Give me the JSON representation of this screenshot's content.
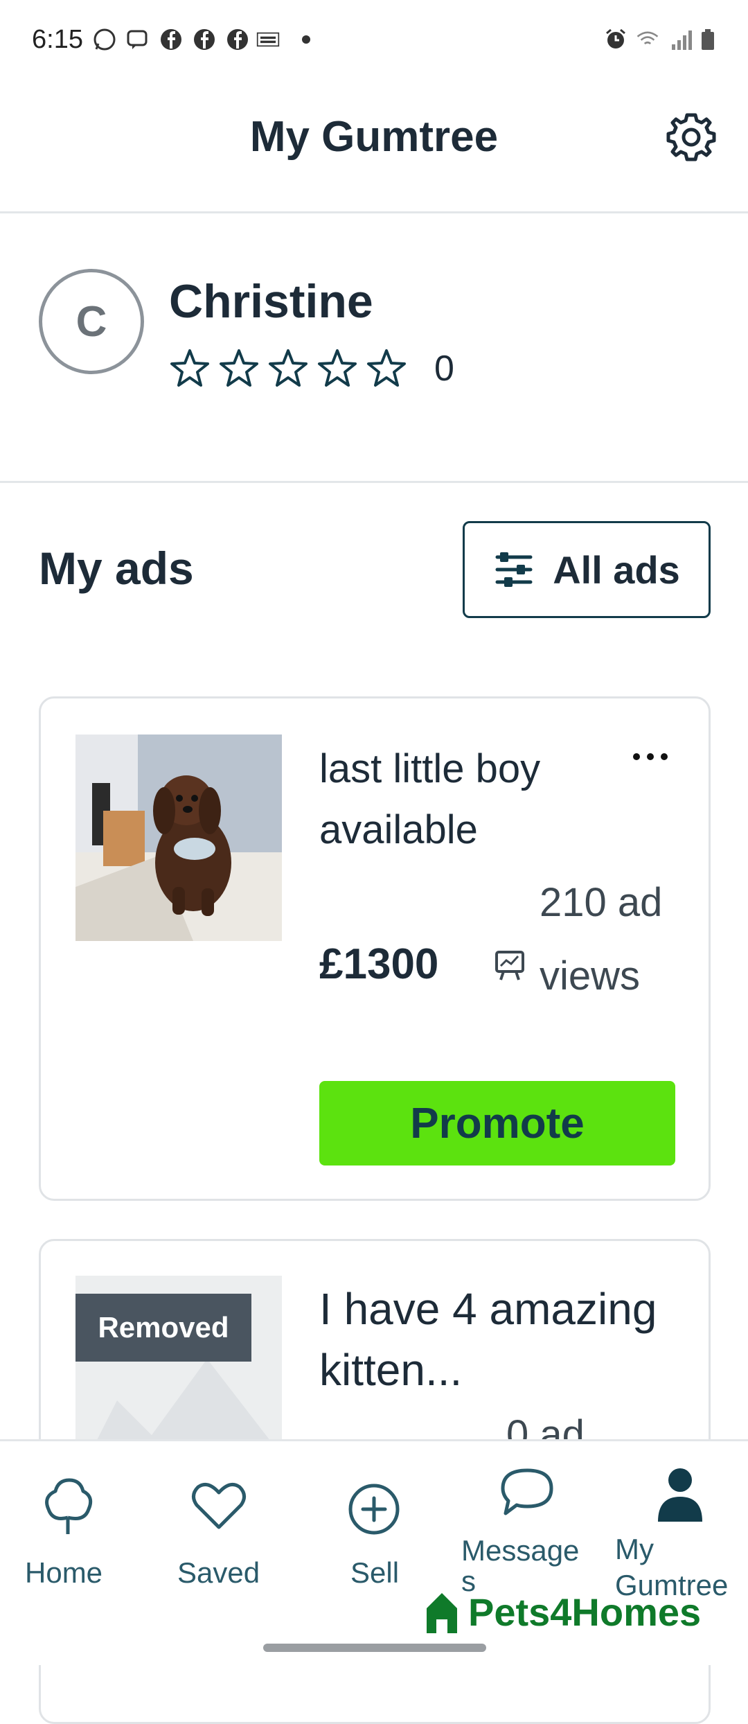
{
  "status_bar": {
    "time": "6:15",
    "left_icons": [
      "whatsapp-icon",
      "messenger-icon",
      "facebook-icon",
      "facebook-icon",
      "facebook-icon",
      "temu-icon",
      "dot-icon"
    ],
    "right_icons": [
      "alarm-icon",
      "wifi-icon",
      "signal-icon",
      "battery-icon"
    ]
  },
  "header": {
    "title": "My Gumtree",
    "settings_icon": "gear-icon"
  },
  "profile": {
    "avatar_initial": "C",
    "name": "Christine",
    "rating_stars": 0,
    "rating_count": "0"
  },
  "my_ads": {
    "title": "My ads",
    "filter_label": "All ads",
    "filter_icon": "sliders-icon",
    "ads": [
      {
        "title": "last  little boy available",
        "views": "210 ad views",
        "price": "£1300",
        "promote_label": "Promote",
        "more_icon": "more-dots-icon"
      },
      {
        "badge": "Removed",
        "title": "I have 4 amazing kitten...",
        "views": "0 ad"
      }
    ]
  },
  "bottom_nav": {
    "items": [
      {
        "label": "Home",
        "icon": "tree-icon"
      },
      {
        "label": "Saved",
        "icon": "heart-icon"
      },
      {
        "label": "Sell",
        "icon": "plus-circle-icon"
      },
      {
        "label": "Message s",
        "icon": "chat-bubble-icon"
      },
      {
        "label": "My Gumtree",
        "icon": "person-icon"
      }
    ]
  },
  "watermark": {
    "text": "Pets4Homes"
  },
  "colors": {
    "primary_text": "#1d2b38",
    "promote_green": "#5ce20f",
    "nav_teal": "#2a5a6a",
    "badge_gray": "#4a5560"
  }
}
